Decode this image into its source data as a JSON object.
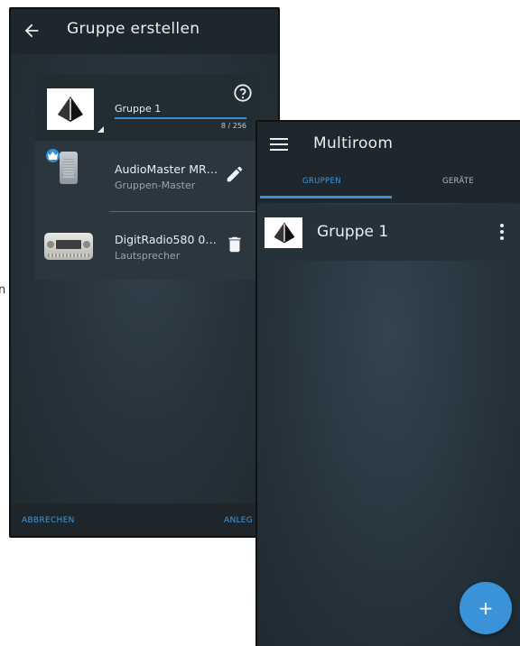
{
  "edge_letter": "n",
  "create_group_screen": {
    "title": "Gruppe erstellen",
    "group_name": "Gruppe 1",
    "char_counter": "8 / 256",
    "devices": [
      {
        "name": "AudioMaster MR…",
        "role": "Gruppen-Master",
        "action_icon": "edit-icon"
      },
      {
        "name": "DigitRadio580 0…",
        "role": "Lautsprecher",
        "action_icon": "delete-icon"
      }
    ],
    "cancel_label": "ABBRECHEN",
    "create_label": "ANLEG"
  },
  "multiroom_screen": {
    "title": "Multiroom",
    "tabs": [
      {
        "label": "GRUPPEN",
        "active": true
      },
      {
        "label": "GERÄTE",
        "active": false
      }
    ],
    "groups": [
      {
        "name": "Gruppe 1"
      }
    ],
    "fab_label": "+"
  },
  "colors": {
    "accent": "#3d8fd1",
    "app_bar": "#1e272d",
    "background": "#283540",
    "text_primary": "#e8eef2",
    "text_secondary": "#98a4ab"
  }
}
